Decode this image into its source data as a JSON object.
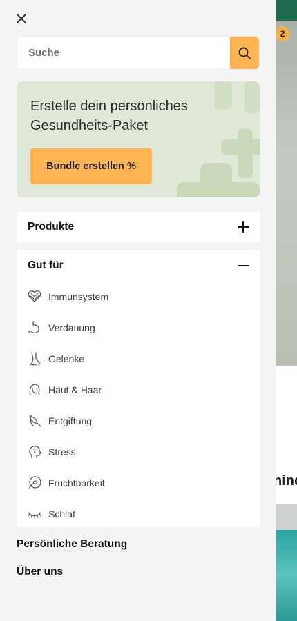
{
  "close_icon": "close-icon",
  "search": {
    "placeholder": "Suche",
    "icon": "search-icon",
    "accent": "#ffb453"
  },
  "promo": {
    "title": "Erstelle dein persönliches Gesundheits-Paket",
    "button_label": "Bundle erstellen %",
    "background": "#dfe8d6"
  },
  "accordion": {
    "products": {
      "label": "Produkte",
      "icon": "plus-icon",
      "expanded": false
    },
    "good_for": {
      "label": "Gut für",
      "icon": "minus-icon",
      "expanded": true,
      "items": [
        {
          "label": "Immunsystem",
          "icon": "immune-heart-icon"
        },
        {
          "label": "Verdauung",
          "icon": "stomach-icon"
        },
        {
          "label": "Gelenke",
          "icon": "joint-leg-icon"
        },
        {
          "label": "Haut & Haar",
          "icon": "face-hair-icon"
        },
        {
          "label": "Entgiftung",
          "icon": "leaf-icon"
        },
        {
          "label": "Stress",
          "icon": "head-stress-icon"
        },
        {
          "label": "Fruchtbarkeit",
          "icon": "fertility-icon"
        },
        {
          "label": "Schlaf",
          "icon": "sleep-eye-icon"
        }
      ]
    }
  },
  "links": {
    "consulting": "Persönliche Beratung",
    "about": "Über uns"
  },
  "background_page": {
    "cart_count": "2",
    "partial_heading": "hind"
  }
}
